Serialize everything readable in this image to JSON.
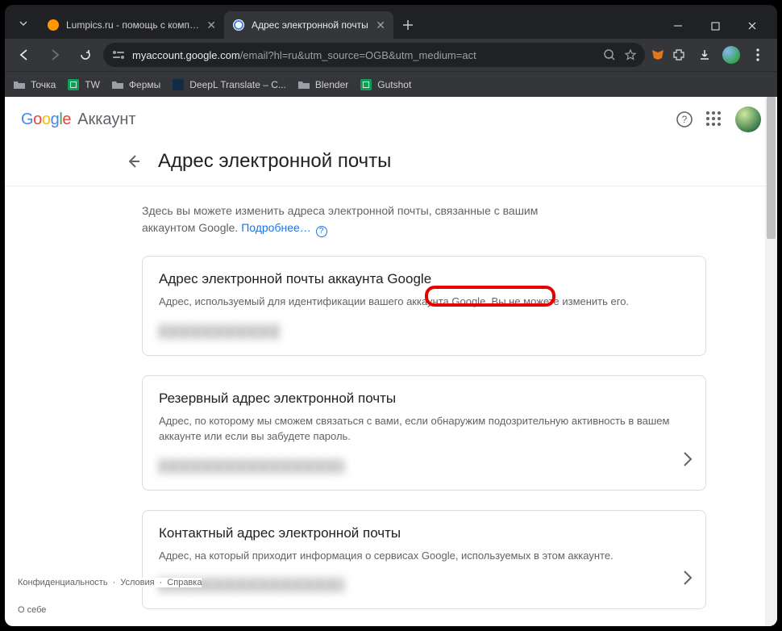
{
  "browser": {
    "tabs": [
      {
        "label": "Lumpics.ru - помощь с компью",
        "active": false
      },
      {
        "label": "Адрес электронной почты",
        "active": true
      }
    ],
    "url_host": "myaccount.google.com",
    "url_path": "/email?hl=ru&utm_source=OGB&utm_medium=act",
    "bookmarks": [
      {
        "label": "Точка",
        "icon": "folder"
      },
      {
        "label": "TW",
        "icon": "sheets"
      },
      {
        "label": "Фермы",
        "icon": "folder"
      },
      {
        "label": "DeepL Translate – C...",
        "icon": "deepl"
      },
      {
        "label": "Blender",
        "icon": "folder"
      },
      {
        "label": "Gutshot",
        "icon": "sheets"
      }
    ]
  },
  "header": {
    "product": "Аккаунт"
  },
  "page": {
    "title": "Адрес электронной почты",
    "intro_text": "Здесь вы можете изменить адреса электронной почты, связанные с вашим аккаунтом Google. ",
    "intro_link": "Подробнее…",
    "cards": {
      "account_email": {
        "title": "Адрес электронной почты аккаунта Google",
        "desc_a": "Адрес, используемый для идентификации вашего аккаунта Google. ",
        "desc_b": "Вы не можете изменить его."
      },
      "recovery_email": {
        "title": "Резервный адрес электронной почты",
        "desc": "Адрес, по которому мы сможем связаться с вами, если обнаружим подозрительную активность в вашем аккаунте или если вы забудете пароль."
      },
      "contact_email": {
        "title": "Контактный адрес электронной почты",
        "desc": "Адрес, на который приходит информация о сервисах Google, используемых в этом аккаунте."
      }
    },
    "footer": {
      "privacy": "Конфиденциальность",
      "terms": "Условия",
      "help": "Справка",
      "about": "О себе"
    }
  }
}
